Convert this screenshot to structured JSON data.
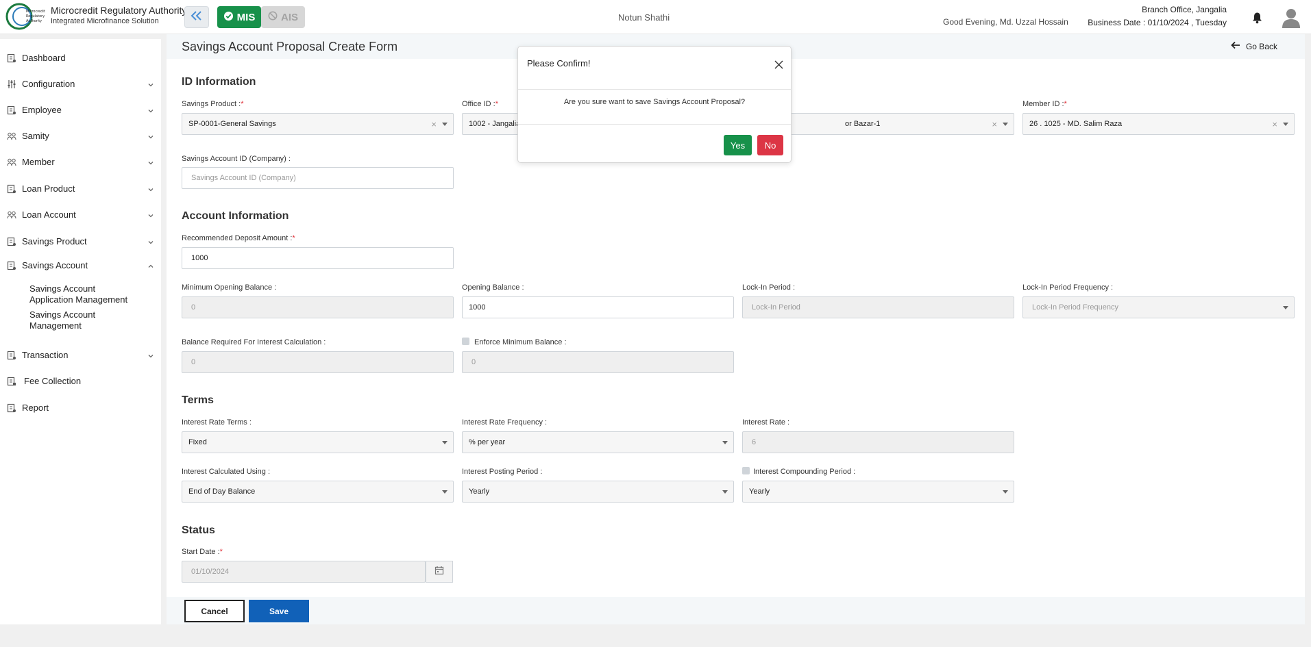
{
  "app": {
    "brand_title": "Microcredit Regulatory Authority",
    "brand_sub": "Integrated Microfinance Solution",
    "mis_label": "MIS",
    "ais_label": "AIS",
    "org_name": "Notun Shathi",
    "greeting": "Good Evening, Md. Uzzal Hossain",
    "branch": "Branch Office, Jangalia",
    "business_date": "Business Date : 01/10/2024 , Tuesday"
  },
  "sidebar": {
    "items": [
      {
        "label": "Dashboard"
      },
      {
        "label": "Configuration"
      },
      {
        "label": "Employee"
      },
      {
        "label": "Samity"
      },
      {
        "label": "Member"
      },
      {
        "label": "Loan Product"
      },
      {
        "label": "Loan Account"
      },
      {
        "label": "Savings Product"
      },
      {
        "label": "Savings Account"
      },
      {
        "label": "Transaction"
      },
      {
        "label": "Fee Collection"
      },
      {
        "label": "Report"
      }
    ],
    "sub_items": [
      {
        "line1": "Savings Account",
        "line2": "Application Management"
      },
      {
        "line1": "Savings Account",
        "line2": "Management"
      }
    ]
  },
  "page": {
    "title": "Savings Account Proposal Create Form",
    "go_back": "Go Back"
  },
  "sections": {
    "id_info": "ID Information",
    "account_info": "Account Information",
    "terms": "Terms",
    "status": "Status"
  },
  "fields": {
    "savings_product": {
      "label": "Savings Product :",
      "value": "SP-0001-General Savings"
    },
    "office_id": {
      "label": "Office ID :",
      "value": "1002 - Jangalia"
    },
    "samity": {
      "value": "or Bazar-1"
    },
    "member_id": {
      "label": "Member ID :",
      "value": "26 . 1025 - MD. Salim Raza"
    },
    "account_id_company": {
      "label": "Savings Account ID (Company) :",
      "placeholder": "Savings Account ID (Company)"
    },
    "recommended_deposit": {
      "label": "Recommended Deposit Amount :",
      "value": "1000"
    },
    "min_opening_balance": {
      "label": "Minimum Opening Balance :",
      "value": "0"
    },
    "opening_balance": {
      "label": "Opening Balance :",
      "value": "1000"
    },
    "lock_in_period": {
      "label": "Lock-In Period :",
      "placeholder": "Lock-In Period"
    },
    "lock_in_frequency": {
      "label": "Lock-In Period Frequency :",
      "placeholder": "Lock-In Period Frequency"
    },
    "balance_required": {
      "label": "Balance Required For Interest Calculation :",
      "value": "0"
    },
    "enforce_min_balance": {
      "label": "Enforce Minimum Balance :",
      "value": "0"
    },
    "interest_rate_terms": {
      "label": "Interest Rate Terms :",
      "value": "Fixed"
    },
    "interest_rate_frequency": {
      "label": "Interest Rate Frequency :",
      "value": "% per year"
    },
    "interest_rate": {
      "label": "Interest Rate :",
      "value": "6"
    },
    "interest_calc_using": {
      "label": "Interest Calculated Using :",
      "value": "End of Day Balance"
    },
    "interest_posting_period": {
      "label": "Interest Posting Period :",
      "value": "Yearly"
    },
    "interest_compounding_period": {
      "label": "Interest Compounding Period :",
      "value": "Yearly"
    },
    "start_date": {
      "label": "Start Date :",
      "value": "01/10/2024"
    }
  },
  "actions": {
    "cancel": "Cancel",
    "save": "Save"
  },
  "dialog": {
    "title": "Please Confirm!",
    "message": "Are you sure want to save Savings Account Proposal?",
    "yes": "Yes",
    "no": "No"
  },
  "colors": {
    "primary": "#1161b8",
    "success": "#17914a",
    "danger": "#dc3545",
    "required": "#e0323a"
  }
}
